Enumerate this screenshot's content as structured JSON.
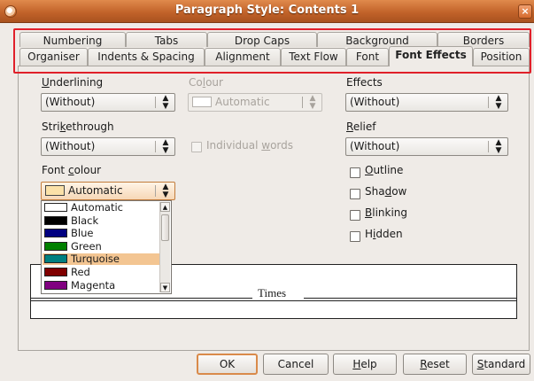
{
  "window": {
    "title": "Paragraph Style: Contents 1",
    "close_glyph": "×"
  },
  "tabs_row1": [
    {
      "label": "Numbering"
    },
    {
      "label": "Tabs"
    },
    {
      "label": "Drop Caps"
    },
    {
      "label": "Background"
    },
    {
      "label": "Borders"
    }
  ],
  "tabs_row2": [
    {
      "label": "Organiser"
    },
    {
      "label": "Indents & Spacing"
    },
    {
      "label": "Alignment"
    },
    {
      "label": "Text Flow"
    },
    {
      "label": "Font"
    },
    {
      "label": "Font Effects"
    },
    {
      "label": "Position"
    }
  ],
  "active_tab": "Font Effects",
  "underlining": {
    "m": "U",
    "rest": "nderlining",
    "value": "(Without)"
  },
  "colour": {
    "pre": "Co",
    "m": "l",
    "rest": "our",
    "value": "Automatic"
  },
  "effects": {
    "label": "Effects",
    "value": "(Without)"
  },
  "strikethrough": {
    "pre": "Stri",
    "m": "k",
    "rest": "ethrough",
    "value": "(Without)"
  },
  "individual_words": {
    "pre": "Individual ",
    "m": "w",
    "rest": "ords",
    "checked": false
  },
  "relief": {
    "m": "R",
    "rest": "elief",
    "value": "(Without)"
  },
  "font_colour": {
    "pre": "Font ",
    "m": "c",
    "rest": "olour",
    "value": "Automatic",
    "swatch_color": "#fbe1a8"
  },
  "checkboxes": {
    "outline": {
      "m": "O",
      "rest": "utline",
      "checked": false
    },
    "shadow": {
      "pre": "Sha",
      "m": "d",
      "rest": "ow",
      "checked": false
    },
    "blinking": {
      "m": "B",
      "rest": "linking",
      "checked": false
    },
    "hidden": {
      "pre": "H",
      "m": "i",
      "rest": "dden",
      "checked": false
    }
  },
  "color_list": [
    {
      "name": "Automatic",
      "color": "#ffffff",
      "selected": false
    },
    {
      "name": "Black",
      "color": "#000000",
      "selected": false
    },
    {
      "name": "Blue",
      "color": "#000080",
      "selected": false
    },
    {
      "name": "Green",
      "color": "#008000",
      "selected": false
    },
    {
      "name": "Turquoise",
      "color": "#008080",
      "selected": true
    },
    {
      "name": "Red",
      "color": "#800000",
      "selected": false
    },
    {
      "name": "Magenta",
      "color": "#800080",
      "selected": false
    }
  ],
  "preview": {
    "sample_text": "Times"
  },
  "buttons": {
    "ok": "OK",
    "cancel": "Cancel",
    "help": {
      "m": "H",
      "rest": "elp"
    },
    "reset": {
      "m": "R",
      "rest": "eset"
    },
    "standard": {
      "m": "S",
      "rest": "tandard"
    }
  },
  "colors": {
    "title_bar": "#c2632a",
    "highlight": "#e0202a",
    "selection": "#f3c592",
    "default_button_border": "#d98a4a"
  }
}
